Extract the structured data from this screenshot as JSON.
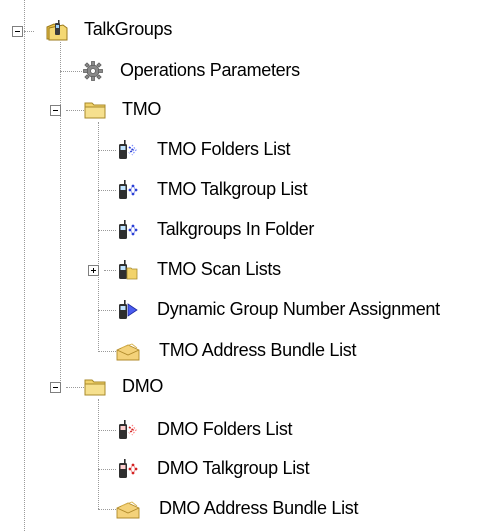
{
  "tree": {
    "root": {
      "label": "TalkGroups",
      "icon": "talkgroups-folder-icon",
      "expanded": true
    },
    "operations": {
      "label": "Operations Parameters",
      "icon": "gear-icon"
    },
    "tmo": {
      "label": "TMO",
      "icon": "folder-icon",
      "expanded": true,
      "items": [
        {
          "label": "TMO Folders List",
          "icon": "radio-folders-icon"
        },
        {
          "label": "TMO Talkgroup List",
          "icon": "radio-talkgroup-icon"
        },
        {
          "label": "Talkgroups In Folder",
          "icon": "radio-talkgroup-icon"
        },
        {
          "label": "TMO Scan Lists",
          "icon": "radio-scan-icon",
          "collapsed": true
        },
        {
          "label": "Dynamic Group Number Assignment",
          "icon": "radio-dynamic-icon"
        },
        {
          "label": "TMO Address Bundle List",
          "icon": "address-bundle-icon"
        }
      ]
    },
    "dmo": {
      "label": "DMO",
      "icon": "folder-icon",
      "expanded": true,
      "items": [
        {
          "label": "DMO Folders List",
          "icon": "radio-folders-red-icon"
        },
        {
          "label": "DMO Talkgroup List",
          "icon": "radio-talkgroup-red-icon"
        },
        {
          "label": "DMO Address Bundle List",
          "icon": "address-bundle-icon"
        }
      ]
    }
  },
  "colors": {
    "tree_line": "#9a9a9a",
    "folder_yellow": "#f2d36b",
    "tmo_accent_blue": "#2a3fd6",
    "dmo_accent_red": "#d42222"
  }
}
